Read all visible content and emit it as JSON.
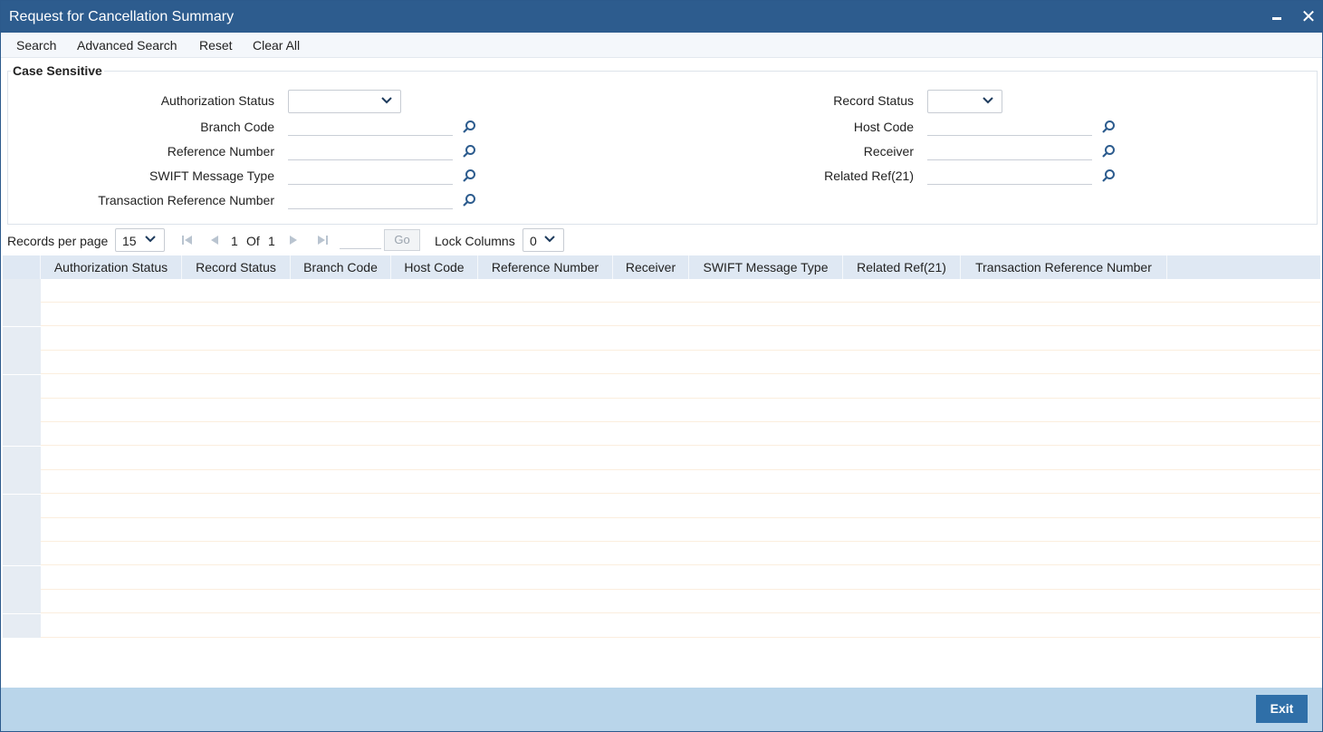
{
  "window": {
    "title": "Request for Cancellation Summary",
    "minimize_icon": "minimize-icon",
    "close_icon": "close-icon"
  },
  "menu": {
    "search": "Search",
    "advanced_search": "Advanced Search",
    "reset": "Reset",
    "clear_all": "Clear All"
  },
  "criteria": {
    "legend": "Case Sensitive",
    "left": {
      "authorization_status": {
        "label": "Authorization Status",
        "value": ""
      },
      "branch_code": {
        "label": "Branch Code",
        "value": ""
      },
      "reference_number": {
        "label": "Reference Number",
        "value": ""
      },
      "swift_message_type": {
        "label": "SWIFT Message Type",
        "value": ""
      },
      "transaction_reference_number": {
        "label": "Transaction Reference Number",
        "value": ""
      }
    },
    "right": {
      "record_status": {
        "label": "Record Status",
        "value": ""
      },
      "host_code": {
        "label": "Host Code",
        "value": ""
      },
      "receiver": {
        "label": "Receiver",
        "value": ""
      },
      "related_ref": {
        "label": "Related Ref(21)",
        "value": ""
      }
    },
    "lookup_icon": "search-icon"
  },
  "pager": {
    "records_per_page_label": "Records per page",
    "records_per_page_value": "15",
    "current_page": "1",
    "of_label": "Of",
    "total_pages": "1",
    "goto_value": "",
    "go_label": "Go",
    "lock_columns_label": "Lock Columns",
    "lock_columns_value": "0"
  },
  "grid": {
    "columns": [
      "Authorization Status",
      "Record Status",
      "Branch Code",
      "Host Code",
      "Reference Number",
      "Receiver",
      "SWIFT Message Type",
      "Related Ref(21)",
      "Transaction Reference Number"
    ],
    "empty_rows": 15
  },
  "footer": {
    "exit_label": "Exit"
  },
  "colors": {
    "titlebar": "#2d5c8e",
    "footer": "#b9d5ea",
    "grid_header": "#dfe8f3",
    "exit_button": "#2f6fa8"
  }
}
